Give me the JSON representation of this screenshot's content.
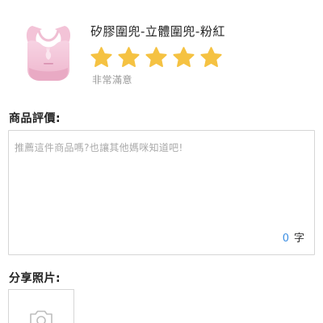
{
  "product": {
    "title": "矽膠圍兜-立體圍兜-粉紅",
    "image_icon": "baby-bib-image"
  },
  "rating": {
    "stars_total": 5,
    "stars_selected": 5,
    "star_color": "#f5c242",
    "label": "非常滿意"
  },
  "review": {
    "section_label": "商品評價:",
    "placeholder": "推薦這件商品嗎?也讓其他媽咪知道吧!",
    "value": "",
    "char_count": "0",
    "char_unit": "字",
    "count_color": "#3d8fe3"
  },
  "photos": {
    "section_label": "分享照片:",
    "upload_icon": "camera-icon"
  }
}
